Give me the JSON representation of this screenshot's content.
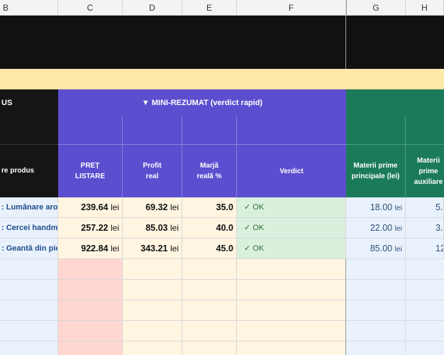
{
  "columns": [
    "B",
    "C",
    "D",
    "E",
    "F",
    "G",
    "H"
  ],
  "banner": {
    "left_label": "US",
    "mini_rezumat": "▼ MINI-REZUMAT (verdict rapid)"
  },
  "headers": {
    "product": "re produs",
    "pret_listare": "PREȚ LISTARE",
    "profit_real": "Profit real",
    "marja_reala": "Marjă reală %",
    "verdict": "Verdict",
    "materii_prime_principale": "Materii prime principale (lei)",
    "materii_prime_auxiliare": "Materii prime auxiliare"
  },
  "currency": "lei",
  "rows": [
    {
      "product": ": Lumânare aror",
      "price": "239.64",
      "profit": "69.32",
      "margin": "35.0",
      "verdict": "✓ OK",
      "materii": "18.00",
      "aux": "5."
    },
    {
      "product": ": Cercei handma",
      "price": "257.22",
      "profit": "85.03",
      "margin": "40.0",
      "verdict": "✓ OK",
      "materii": "22.00",
      "aux": "3."
    },
    {
      "product": ": Geantă din pie",
      "price": "922.84",
      "profit": "343.21",
      "margin": "45.0",
      "verdict": "✓ OK",
      "materii": "85.00",
      "aux": "12."
    }
  ],
  "colors": {
    "black_band": "#111111",
    "cream_band": "#fde9a9",
    "purple": "#5b4fcf",
    "green": "#1b7a5a",
    "product_blue": "#1f4e8c",
    "verdict_green_bg": "#d9f0dc",
    "price_pink": "#ffd6d0",
    "light_blue": "#e9f2fc",
    "cream_cell": "#fff5e1"
  }
}
